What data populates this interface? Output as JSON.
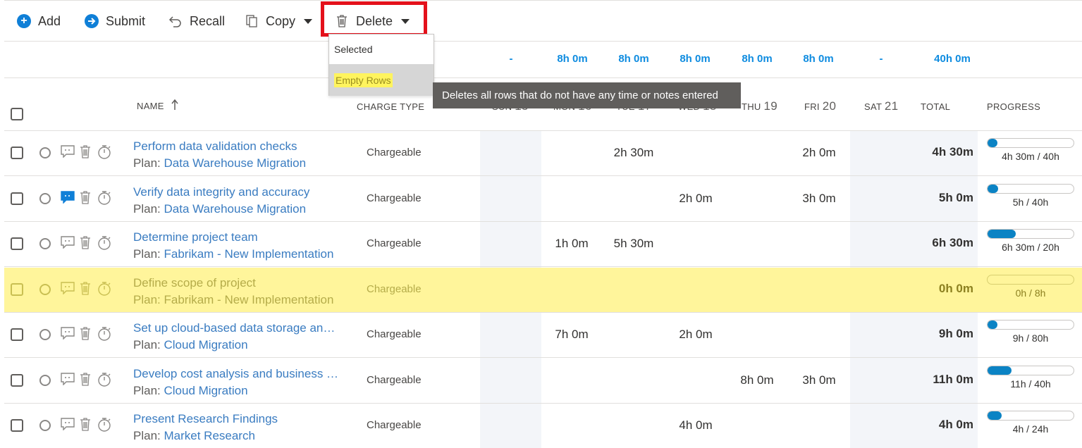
{
  "toolbar": {
    "add_label": "Add",
    "submit_label": "Submit",
    "recall_label": "Recall",
    "copy_label": "Copy",
    "delete_label": "Delete"
  },
  "delete_menu": {
    "items": [
      "Selected",
      "Empty Rows"
    ],
    "tooltip": "Deletes all rows that do not have any time or notes entered"
  },
  "summary": {
    "sun": "-",
    "mon": "8h 0m",
    "tue": "8h 0m",
    "wed": "8h 0m",
    "thu": "8h 0m",
    "fri": "8h 0m",
    "sat": "-",
    "total": "40h 0m"
  },
  "header": {
    "name": "NAME",
    "charge_type": "CHARGE TYPE",
    "sun": "SUN",
    "sun_num": "15",
    "mon": "MON",
    "mon_num": "16",
    "tue": "TUE",
    "tue_num": "17",
    "wed": "WED",
    "wed_num": "18",
    "thu": "THU",
    "thu_num": "19",
    "fri": "FRI",
    "fri_num": "20",
    "sat": "SAT",
    "sat_num": "21",
    "total": "TOTAL",
    "progress": "PROGRESS"
  },
  "plan_prefix": "Plan:",
  "rows": [
    {
      "task": "Perform data validation checks",
      "plan": "Data Warehouse Migration",
      "charge": "Chargeable",
      "mon": "",
      "tue": "2h 30m",
      "wed": "",
      "thu": "",
      "fri": "2h 0m",
      "total": "4h 30m",
      "progress_label": "4h 30m / 40h",
      "progress": 0.1125,
      "note_active": false
    },
    {
      "task": "Verify data integrity and accuracy",
      "plan": "Data Warehouse Migration",
      "charge": "Chargeable",
      "mon": "",
      "tue": "",
      "wed": "2h 0m",
      "thu": "",
      "fri": "3h 0m",
      "total": "5h 0m",
      "progress_label": "5h / 40h",
      "progress": 0.125,
      "note_active": true
    },
    {
      "task": "Determine project team",
      "plan": "Fabrikam - New Implementation",
      "charge": "Chargeable",
      "mon": "1h 0m",
      "tue": "5h 30m",
      "wed": "",
      "thu": "",
      "fri": "",
      "total": "6h 30m",
      "progress_label": "6h 30m / 20h",
      "progress": 0.325,
      "note_active": false
    },
    {
      "task": "Define scope of project",
      "plan": "Fabrikam - New Implementation",
      "charge": "Chargeable",
      "mon": "",
      "tue": "",
      "wed": "",
      "thu": "",
      "fri": "",
      "total": "0h 0m",
      "progress_label": "0h / 8h",
      "progress": 0,
      "note_active": false,
      "highlighted": true
    },
    {
      "task": "Set up cloud-based data storage an…",
      "plan": "Cloud Migration",
      "charge": "Chargeable",
      "mon": "7h 0m",
      "tue": "",
      "wed": "2h 0m",
      "thu": "",
      "fri": "",
      "total": "9h 0m",
      "progress_label": "9h / 80h",
      "progress": 0.1125,
      "note_active": false
    },
    {
      "task": "Develop cost analysis and business …",
      "plan": "Cloud Migration",
      "charge": "Chargeable",
      "mon": "",
      "tue": "",
      "wed": "",
      "thu": "8h 0m",
      "fri": "3h 0m",
      "total": "11h 0m",
      "progress_label": "11h / 40h",
      "progress": 0.275,
      "note_active": false
    },
    {
      "task": "Present Research Findings",
      "plan": "Market Research",
      "charge": "Chargeable",
      "mon": "",
      "tue": "",
      "wed": "4h 0m",
      "thu": "",
      "fri": "",
      "total": "4h 0m",
      "progress_label": "4h / 24h",
      "progress": 0.1667,
      "note_active": false
    }
  ],
  "colors": {
    "accent": "#0f7fd7",
    "link": "#3a7cc1",
    "highlight": "#fff59b",
    "delete_outline": "#e4111b",
    "progress_fill": "#0b83c4"
  }
}
